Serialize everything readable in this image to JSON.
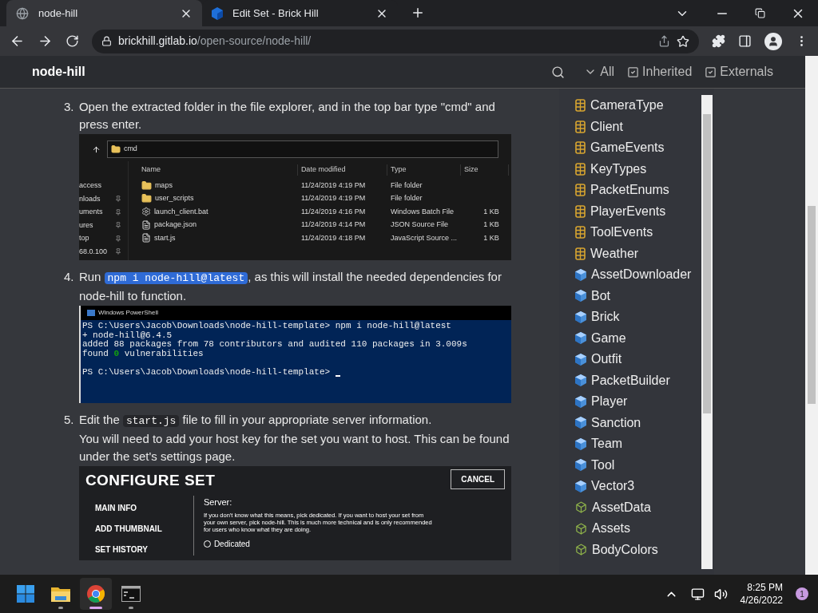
{
  "tabs": [
    {
      "title": "node-hill",
      "selected": true,
      "kind": "globe"
    },
    {
      "title": "Edit Set - Brick Hill",
      "selected": false,
      "kind": "brand"
    }
  ],
  "address": {
    "host": "brickhill.gitlab.io",
    "path": "/open-source/node-hill/"
  },
  "header": {
    "title": "node-hill",
    "filters": [
      {
        "label": "All",
        "kind": "dropdown"
      },
      {
        "label": "Inherited",
        "kind": "checkbox",
        "checked": true
      },
      {
        "label": "Externals",
        "kind": "checkbox",
        "checked": true
      }
    ]
  },
  "steps": [
    {
      "number": "3.",
      "paragraphs": [
        [
          {
            "kind": "text",
            "text": "Open the extracted folder in the file explorer, and in the top bar type \"cmd\" and press enter."
          }
        ]
      ],
      "figure": {
        "kind": "explorer",
        "address": "cmd",
        "nav": [
          "access",
          "nloads",
          "uments",
          "ures",
          "top",
          "68.0.100"
        ],
        "columns": [
          "Name",
          "Date modified",
          "Type",
          "Size"
        ],
        "rows": [
          {
            "name": "maps",
            "kind": "folder",
            "date": "11/24/2019 4:19 PM",
            "type": "File folder",
            "size": ""
          },
          {
            "name": "user_scripts",
            "kind": "folder",
            "date": "11/24/2019 4:19 PM",
            "type": "File folder",
            "size": ""
          },
          {
            "name": "launch_client.bat",
            "kind": "gear",
            "date": "11/24/2019 4:16 PM",
            "type": "Windows Batch File",
            "size": "1 KB"
          },
          {
            "name": "package.json",
            "kind": "file",
            "date": "11/24/2019 4:14 PM",
            "type": "JSON Source File",
            "size": "1 KB"
          },
          {
            "name": "start.js",
            "kind": "file",
            "date": "11/24/2019 4:18 PM",
            "type": "JavaScript Source ...",
            "size": "1 KB"
          }
        ]
      }
    },
    {
      "number": "4.",
      "paragraphs": [
        [
          {
            "kind": "text",
            "text": "Run "
          },
          {
            "kind": "code",
            "text": "npm i node-hill@latest",
            "selected": true
          },
          {
            "kind": "text",
            "text": ", as this will install the needed dependencies for node-hill to function."
          }
        ]
      ],
      "figure": {
        "kind": "terminal",
        "title": "Windows PowerShell",
        "lines": [
          {
            "kind": "text",
            "segments": [
              {
                "text": "PS C:\\Users\\Jacob\\Downloads\\node-hill-template> npm i node-hill@latest"
              }
            ]
          },
          {
            "kind": "text",
            "segments": [
              {
                "text": "+ node-hill@6.4.5"
              }
            ]
          },
          {
            "kind": "text",
            "segments": [
              {
                "text": "added 88 packages from 78 contributors and audited 110 packages in 3.009s"
              }
            ]
          },
          {
            "kind": "text",
            "segments": [
              {
                "text": "found "
              },
              {
                "text": "0",
                "color": "#13a10e"
              },
              {
                "text": " vulnerabilities"
              }
            ]
          },
          {
            "kind": "blank"
          },
          {
            "kind": "prompt",
            "segments": [
              {
                "text": "PS C:\\Users\\Jacob\\Downloads\\node-hill-template> "
              }
            ]
          }
        ]
      }
    },
    {
      "number": "5.",
      "paragraphs": [
        [
          {
            "kind": "text",
            "text": "Edit the "
          },
          {
            "kind": "code",
            "text": "start.js",
            "selected": false
          },
          {
            "kind": "text",
            "text": " file to fill in your appropriate server information."
          }
        ],
        [
          {
            "kind": "text",
            "text": "You will need to add your host key for the set you want to host. This can be found under the set's settings page."
          }
        ]
      ],
      "figure": {
        "kind": "configure",
        "title": "CONFIGURE SET",
        "cancel": "CANCEL",
        "nav": [
          "MAIN INFO",
          "ADD THUMBNAIL",
          "SET HISTORY"
        ],
        "label": "Server:",
        "description": "If you don't know what this means, pick dedicated. If you want to host your set from your own server, pick node-hill. This is much more technical and is only recommended for users who know what they are doing.",
        "option": {
          "label": "Dedicated",
          "selected": false
        }
      }
    }
  ],
  "sidebar": [
    {
      "name": "CameraType",
      "kind": "enum"
    },
    {
      "name": "Client",
      "kind": "enum"
    },
    {
      "name": "GameEvents",
      "kind": "enum"
    },
    {
      "name": "KeyTypes",
      "kind": "enum"
    },
    {
      "name": "PacketEnums",
      "kind": "enum"
    },
    {
      "name": "PlayerEvents",
      "kind": "enum"
    },
    {
      "name": "ToolEvents",
      "kind": "enum"
    },
    {
      "name": "Weather",
      "kind": "enum"
    },
    {
      "name": "AssetDownloader",
      "kind": "class"
    },
    {
      "name": "Bot",
      "kind": "class"
    },
    {
      "name": "Brick",
      "kind": "class"
    },
    {
      "name": "Game",
      "kind": "class"
    },
    {
      "name": "Outfit",
      "kind": "class"
    },
    {
      "name": "PacketBuilder",
      "kind": "class"
    },
    {
      "name": "Player",
      "kind": "class"
    },
    {
      "name": "Sanction",
      "kind": "class"
    },
    {
      "name": "Team",
      "kind": "class"
    },
    {
      "name": "Tool",
      "kind": "class"
    },
    {
      "name": "Vector3",
      "kind": "class"
    },
    {
      "name": "AssetData",
      "kind": "interface"
    },
    {
      "name": "Assets",
      "kind": "interface"
    },
    {
      "name": "BodyColors",
      "kind": "interface"
    }
  ],
  "taskbar": {
    "apps": [
      {
        "kind": "start",
        "running": false,
        "active": false
      },
      {
        "kind": "folder",
        "running": true,
        "active": false
      },
      {
        "kind": "browser",
        "running": true,
        "active": true
      },
      {
        "kind": "terminal",
        "running": true,
        "active": false
      }
    ],
    "time": "8:25 PM",
    "date": "4/26/2022",
    "notifications": "1"
  }
}
